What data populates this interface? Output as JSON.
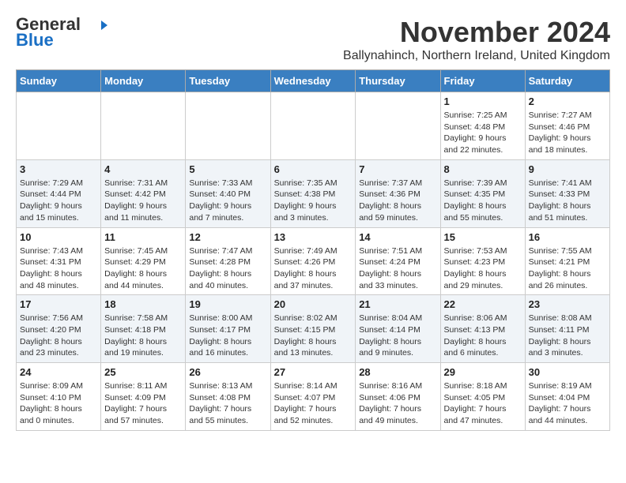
{
  "logo": {
    "line1": "General",
    "line2": "Blue",
    "arrow": "▶"
  },
  "header": {
    "month_year": "November 2024",
    "location": "Ballynahinch, Northern Ireland, United Kingdom"
  },
  "weekdays": [
    "Sunday",
    "Monday",
    "Tuesday",
    "Wednesday",
    "Thursday",
    "Friday",
    "Saturday"
  ],
  "weeks": [
    {
      "cells": [
        {
          "day": "",
          "info": ""
        },
        {
          "day": "",
          "info": ""
        },
        {
          "day": "",
          "info": ""
        },
        {
          "day": "",
          "info": ""
        },
        {
          "day": "",
          "info": ""
        },
        {
          "day": "1",
          "info": "Sunrise: 7:25 AM\nSunset: 4:48 PM\nDaylight: 9 hours\nand 22 minutes."
        },
        {
          "day": "2",
          "info": "Sunrise: 7:27 AM\nSunset: 4:46 PM\nDaylight: 9 hours\nand 18 minutes."
        }
      ]
    },
    {
      "cells": [
        {
          "day": "3",
          "info": "Sunrise: 7:29 AM\nSunset: 4:44 PM\nDaylight: 9 hours\nand 15 minutes."
        },
        {
          "day": "4",
          "info": "Sunrise: 7:31 AM\nSunset: 4:42 PM\nDaylight: 9 hours\nand 11 minutes."
        },
        {
          "day": "5",
          "info": "Sunrise: 7:33 AM\nSunset: 4:40 PM\nDaylight: 9 hours\nand 7 minutes."
        },
        {
          "day": "6",
          "info": "Sunrise: 7:35 AM\nSunset: 4:38 PM\nDaylight: 9 hours\nand 3 minutes."
        },
        {
          "day": "7",
          "info": "Sunrise: 7:37 AM\nSunset: 4:36 PM\nDaylight: 8 hours\nand 59 minutes."
        },
        {
          "day": "8",
          "info": "Sunrise: 7:39 AM\nSunset: 4:35 PM\nDaylight: 8 hours\nand 55 minutes."
        },
        {
          "day": "9",
          "info": "Sunrise: 7:41 AM\nSunset: 4:33 PM\nDaylight: 8 hours\nand 51 minutes."
        }
      ]
    },
    {
      "cells": [
        {
          "day": "10",
          "info": "Sunrise: 7:43 AM\nSunset: 4:31 PM\nDaylight: 8 hours\nand 48 minutes."
        },
        {
          "day": "11",
          "info": "Sunrise: 7:45 AM\nSunset: 4:29 PM\nDaylight: 8 hours\nand 44 minutes."
        },
        {
          "day": "12",
          "info": "Sunrise: 7:47 AM\nSunset: 4:28 PM\nDaylight: 8 hours\nand 40 minutes."
        },
        {
          "day": "13",
          "info": "Sunrise: 7:49 AM\nSunset: 4:26 PM\nDaylight: 8 hours\nand 37 minutes."
        },
        {
          "day": "14",
          "info": "Sunrise: 7:51 AM\nSunset: 4:24 PM\nDaylight: 8 hours\nand 33 minutes."
        },
        {
          "day": "15",
          "info": "Sunrise: 7:53 AM\nSunset: 4:23 PM\nDaylight: 8 hours\nand 29 minutes."
        },
        {
          "day": "16",
          "info": "Sunrise: 7:55 AM\nSunset: 4:21 PM\nDaylight: 8 hours\nand 26 minutes."
        }
      ]
    },
    {
      "cells": [
        {
          "day": "17",
          "info": "Sunrise: 7:56 AM\nSunset: 4:20 PM\nDaylight: 8 hours\nand 23 minutes."
        },
        {
          "day": "18",
          "info": "Sunrise: 7:58 AM\nSunset: 4:18 PM\nDaylight: 8 hours\nand 19 minutes."
        },
        {
          "day": "19",
          "info": "Sunrise: 8:00 AM\nSunset: 4:17 PM\nDaylight: 8 hours\nand 16 minutes."
        },
        {
          "day": "20",
          "info": "Sunrise: 8:02 AM\nSunset: 4:15 PM\nDaylight: 8 hours\nand 13 minutes."
        },
        {
          "day": "21",
          "info": "Sunrise: 8:04 AM\nSunset: 4:14 PM\nDaylight: 8 hours\nand 9 minutes."
        },
        {
          "day": "22",
          "info": "Sunrise: 8:06 AM\nSunset: 4:13 PM\nDaylight: 8 hours\nand 6 minutes."
        },
        {
          "day": "23",
          "info": "Sunrise: 8:08 AM\nSunset: 4:11 PM\nDaylight: 8 hours\nand 3 minutes."
        }
      ]
    },
    {
      "cells": [
        {
          "day": "24",
          "info": "Sunrise: 8:09 AM\nSunset: 4:10 PM\nDaylight: 8 hours\nand 0 minutes."
        },
        {
          "day": "25",
          "info": "Sunrise: 8:11 AM\nSunset: 4:09 PM\nDaylight: 7 hours\nand 57 minutes."
        },
        {
          "day": "26",
          "info": "Sunrise: 8:13 AM\nSunset: 4:08 PM\nDaylight: 7 hours\nand 55 minutes."
        },
        {
          "day": "27",
          "info": "Sunrise: 8:14 AM\nSunset: 4:07 PM\nDaylight: 7 hours\nand 52 minutes."
        },
        {
          "day": "28",
          "info": "Sunrise: 8:16 AM\nSunset: 4:06 PM\nDaylight: 7 hours\nand 49 minutes."
        },
        {
          "day": "29",
          "info": "Sunrise: 8:18 AM\nSunset: 4:05 PM\nDaylight: 7 hours\nand 47 minutes."
        },
        {
          "day": "30",
          "info": "Sunrise: 8:19 AM\nSunset: 4:04 PM\nDaylight: 7 hours\nand 44 minutes."
        }
      ]
    }
  ]
}
